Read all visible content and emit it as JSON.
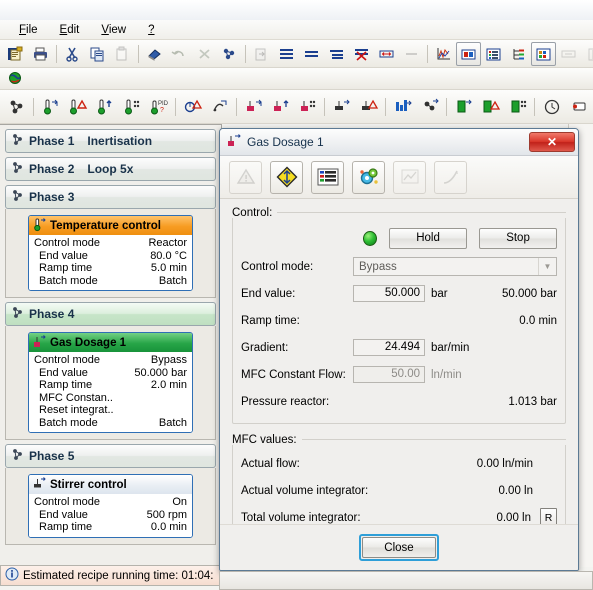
{
  "menu": {
    "items": [
      {
        "label": "File",
        "accel": "F"
      },
      {
        "label": "Edit",
        "accel": "E"
      },
      {
        "label": "View",
        "accel": "V"
      },
      {
        "label": "?",
        "accel": ""
      }
    ]
  },
  "toolbars": {
    "row1": [
      {
        "name": "new-recipe-icon"
      },
      {
        "name": "print-icon"
      },
      {
        "name": "cut-icon"
      },
      {
        "name": "copy-icon"
      },
      {
        "name": "paste-icon"
      },
      {
        "name": "eraser-icon"
      },
      {
        "name": "undo-icon"
      },
      {
        "name": "delete-icon"
      },
      {
        "name": "settings-icon"
      },
      {
        "name": "import-icon"
      },
      {
        "name": "insert-row-icon"
      },
      {
        "name": "insert-line-icon"
      },
      {
        "name": "insert-block-icon"
      },
      {
        "name": "delete-row-icon"
      },
      {
        "name": "resize-icon"
      },
      {
        "name": "grid-icon"
      },
      {
        "name": "chart-curve-icon"
      },
      {
        "name": "image-view-icon"
      },
      {
        "name": "list-view-icon"
      },
      {
        "name": "tree-view-icon"
      },
      {
        "name": "table-view-icon"
      },
      {
        "name": "measure-icon"
      },
      {
        "name": "ruler-icon"
      },
      {
        "name": "zoom-icon"
      }
    ],
    "row2": [
      {
        "name": "globe-icon"
      }
    ],
    "row3": [
      {
        "name": "recipe-node-icon"
      },
      {
        "name": "temperature-set-icon"
      },
      {
        "name": "temperature-alarm-icon"
      },
      {
        "name": "temperature-ramp-icon"
      },
      {
        "name": "temperature-batch-icon"
      },
      {
        "name": "temperature-pid-icon"
      },
      {
        "name": "cooling-alarm-icon"
      },
      {
        "name": "reaction-icon"
      },
      {
        "name": "dosage-set-icon"
      },
      {
        "name": "dosage-ramp-icon"
      },
      {
        "name": "dosage-batch-icon"
      },
      {
        "name": "stirrer-set-icon"
      },
      {
        "name": "stirrer-ramp-icon"
      },
      {
        "name": "stirrer-alarm-icon"
      },
      {
        "name": "balance-icon"
      },
      {
        "name": "pump-icon"
      },
      {
        "name": "device-set-icon"
      },
      {
        "name": "device-alarm-icon"
      },
      {
        "name": "device-batch-icon"
      },
      {
        "name": "timer-icon"
      },
      {
        "name": "comment-icon"
      },
      {
        "name": "loop-icon"
      },
      {
        "name": "wait-icon"
      },
      {
        "name": "end-icon"
      }
    ]
  },
  "recipe": {
    "phases": [
      {
        "title": "Phase 1",
        "subtitle": "Inertisation",
        "green": false,
        "card": null
      },
      {
        "title": "Phase 2",
        "subtitle": "Loop 5x",
        "green": false,
        "card": null
      },
      {
        "title": "Phase 3",
        "subtitle": "",
        "green": false,
        "card": {
          "header": "Temperature control",
          "header_style": "orange",
          "icon": "temperature-control-icon",
          "rows": [
            {
              "key": "Control mode",
              "value": "Reactor",
              "indent": false
            },
            {
              "key": "End value",
              "value": "80.0 °C",
              "indent": true
            },
            {
              "key": "Ramp time",
              "value": "5.0 min",
              "indent": true
            },
            {
              "key": "Batch mode",
              "value": "Batch",
              "indent": true
            }
          ]
        }
      },
      {
        "title": "Phase 4",
        "subtitle": "",
        "green": true,
        "card": {
          "header": "Gas Dosage 1",
          "header_style": "green",
          "icon": "gas-dosage-icon",
          "rows": [
            {
              "key": "Control mode",
              "value": "Bypass",
              "indent": false
            },
            {
              "key": "End value",
              "value": "50.000 bar",
              "indent": true
            },
            {
              "key": "Ramp time",
              "value": "2.0 min",
              "indent": true
            },
            {
              "key": "MFC Constan..",
              "value": "",
              "indent": true
            },
            {
              "key": "Reset integrat..",
              "value": "",
              "indent": true
            },
            {
              "key": "Batch mode",
              "value": "Batch",
              "indent": true
            }
          ]
        }
      },
      {
        "title": "Phase 5",
        "subtitle": "",
        "green": false,
        "card": {
          "header": "Stirrer control",
          "header_style": "blue",
          "icon": "stirrer-control-icon",
          "rows": [
            {
              "key": "Control mode",
              "value": "On",
              "indent": false
            },
            {
              "key": "End value",
              "value": "500 rpm",
              "indent": true
            },
            {
              "key": "Ramp time",
              "value": "0.0 min",
              "indent": true
            }
          ]
        }
      }
    ],
    "status": {
      "icon": "info-icon",
      "text": "Estimated recipe running time: 01:04:"
    }
  },
  "dialog": {
    "title": "Gas Dosage 1",
    "title_icon": "gas-dosage-icon",
    "close_x": "✕",
    "tools": [
      {
        "name": "alarm-triangle-icon",
        "enabled": false
      },
      {
        "name": "diamond-warning-icon",
        "enabled": true
      },
      {
        "name": "legend-list-icon",
        "enabled": true
      },
      {
        "name": "configuration-gear-icon",
        "enabled": true
      },
      {
        "name": "trend-chart-icon",
        "enabled": false
      },
      {
        "name": "curve-icon",
        "enabled": false
      }
    ],
    "control_group": {
      "label": "Control:",
      "led": "status-led-green",
      "hold_label": "Hold",
      "stop_label": "Stop",
      "control_mode": {
        "label": "Control mode:",
        "value": "Bypass"
      },
      "rows": [
        {
          "label": "End value:",
          "field": "50.000",
          "field_dim": false,
          "unit": "bar",
          "right": "50.000 bar"
        },
        {
          "label": "Ramp time:",
          "field": null,
          "field_dim": false,
          "unit": "",
          "right": "0.0 min"
        },
        {
          "label": "Gradient:",
          "field": "24.494",
          "field_dim": false,
          "unit": "bar/min",
          "right": ""
        },
        {
          "label": "MFC Constant Flow:",
          "field": "50.00",
          "field_dim": true,
          "unit": "ln/min",
          "right": ""
        },
        {
          "label": "Pressure reactor:",
          "field": null,
          "field_dim": false,
          "unit": "",
          "right": "1.013 bar"
        }
      ]
    },
    "mfc_group": {
      "label": "MFC values:",
      "rows": [
        {
          "label": "Actual flow:",
          "value": "0.00 ln/min",
          "reset": false
        },
        {
          "label": "Actual volume integrator:",
          "value": "0.00 ln",
          "reset": false
        },
        {
          "label": "Total volume integrator:",
          "value": "0.00 ln",
          "reset": true
        }
      ],
      "reset_label": "R"
    },
    "close_button": "Close"
  }
}
